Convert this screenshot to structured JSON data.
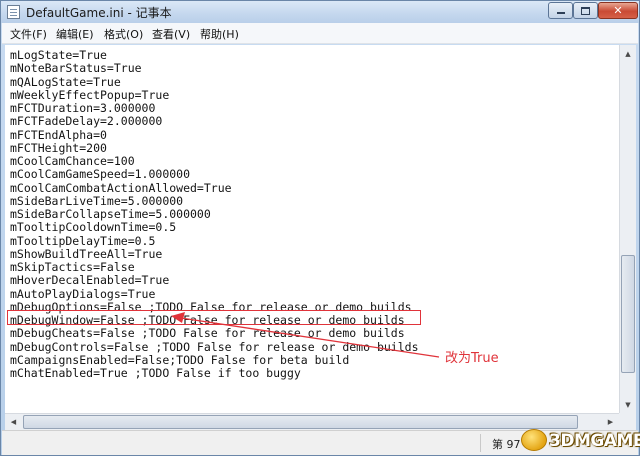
{
  "window": {
    "title": "DefaultGame.ini - 记事本",
    "min_glyph": "minimize",
    "max_glyph": "maximize",
    "close_glyph": "✕"
  },
  "menu": {
    "items": [
      {
        "label": "文件(F)"
      },
      {
        "label": "编辑(E)"
      },
      {
        "label": "格式(O)"
      },
      {
        "label": "查看(V)"
      },
      {
        "label": "帮助(H)"
      }
    ]
  },
  "editor": {
    "lines": [
      "mLogState=True",
      "mNoteBarStatus=True",
      "mQALogState=True",
      "mWeeklyEffectPopup=True",
      "mFCTDuration=3.000000",
      "mFCTFadeDelay=2.000000",
      "mFCTEndAlpha=0",
      "mFCTHeight=200",
      "mCoolCamChance=100",
      "mCoolCamGameSpeed=1.000000",
      "mCoolCamCombatActionAllowed=True",
      "mSideBarLiveTime=5.000000",
      "mSideBarCollapseTime=5.000000",
      "mTooltipCooldownTime=0.5",
      "mTooltipDelayTime=0.5",
      "mShowBuildTreeAll=True",
      "mSkipTactics=False",
      "mHoverDecalEnabled=True",
      "mAutoPlayDialogs=True",
      "mDebugOptions=False ;TODO False for release or demo builds",
      "mDebugWindow=False ;TODO False for release or demo builds",
      "mDebugCheats=False ;TODO False for release or demo builds",
      "mDebugControls=False ;TODO False for release or demo builds",
      "mCampaignsEnabled=False;TODO False for beta build",
      "mChatEnabled=True ;TODO False if too buggy"
    ]
  },
  "annotation": {
    "text": "改为True",
    "color": "#e0333a"
  },
  "statusbar": {
    "position_text": "第 97"
  },
  "watermark": {
    "text": "3DMGAME"
  },
  "icons": {
    "app": "notepad-icon",
    "scroll_up": "▲",
    "scroll_down": "▼",
    "scroll_left": "◀",
    "scroll_right": "▶"
  }
}
